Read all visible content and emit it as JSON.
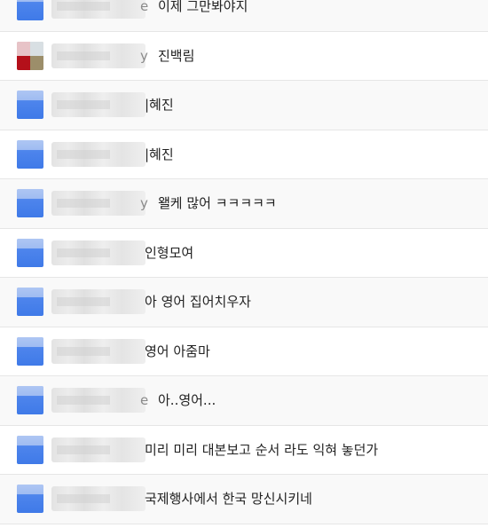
{
  "messages": [
    {
      "avatar": "blue-avatar",
      "tail": "e",
      "text": "이제 그만봐야지",
      "alt": true,
      "close": false
    },
    {
      "avatar": "photo-avatar",
      "tail": "y",
      "text": "진백림",
      "alt": false,
      "close": false
    },
    {
      "avatar": "blue-avatar",
      "tail": "",
      "text": "|혜진",
      "alt": true,
      "close": true
    },
    {
      "avatar": "blue-avatar",
      "tail": "",
      "text": "|혜진",
      "alt": false,
      "close": true
    },
    {
      "avatar": "blue-avatar",
      "tail": "y",
      "text": "왤케 많어 ㅋㅋㅋㅋㅋ",
      "alt": true,
      "close": false
    },
    {
      "avatar": "blue-avatar",
      "tail": "",
      "text": "인형모여",
      "alt": false,
      "close": true
    },
    {
      "avatar": "blue-avatar",
      "tail": "",
      "text": "아 영어 집어치우자",
      "alt": true,
      "close": true
    },
    {
      "avatar": "blue-avatar",
      "tail": "",
      "text": "영어 아줌마",
      "alt": false,
      "close": true
    },
    {
      "avatar": "blue-avatar",
      "tail": "e",
      "text": "아..영어...",
      "alt": true,
      "close": false
    },
    {
      "avatar": "blue-avatar",
      "tail": "",
      "text": "미리 미리 대본보고 순서 라도 익혀 놓던가",
      "alt": false,
      "close": true
    },
    {
      "avatar": "blue-avatar",
      "tail": "",
      "text": "국제행사에서 한국 망신시키네",
      "alt": true,
      "close": true
    }
  ]
}
